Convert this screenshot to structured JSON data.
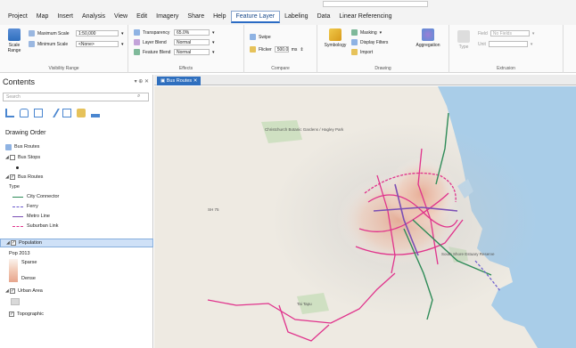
{
  "menubar": {
    "items": [
      "Project",
      "Map",
      "Insert",
      "Analysis",
      "View",
      "Edit",
      "Imagery",
      "Share",
      "Help",
      "Feature Layer",
      "Labeling",
      "Data",
      "Linear Referencing"
    ],
    "active_index": 9
  },
  "ribbon": {
    "visibility_range": {
      "scale_range_label": "Scale Range",
      "max_scale_label": "Maximum Scale",
      "max_scale_value": "1:50,000",
      "min_scale_label": "Minimum Scale",
      "min_scale_value": "<None>",
      "group_label": "Visibility Range"
    },
    "effects": {
      "transparency_label": "Transparency",
      "transparency_value": "65.0%",
      "layer_blend_label": "Layer Blend",
      "layer_blend_value": "Normal",
      "feature_blend_label": "Feature Blend",
      "feature_blend_value": "Normal",
      "group_label": "Effects"
    },
    "compare": {
      "swipe_label": "Swipe",
      "flicker_label": "Flicker",
      "flicker_value": "500.0",
      "flicker_unit": "ms",
      "group_label": "Compare"
    },
    "drawing": {
      "symbology_label": "Symbology",
      "masking_label": "Masking",
      "display_filters_label": "Display Filters",
      "import_label": "Import",
      "aggregation_label": "Aggregation",
      "group_label": "Drawing"
    },
    "extrusion": {
      "type_label": "Type",
      "field_label": "Field",
      "field_value": "No Fields",
      "unit_label": "Unit",
      "group_label": "Extrusion"
    }
  },
  "contents": {
    "title": "Contents",
    "search_placeholder": "Search",
    "drawing_order_label": "Drawing Order",
    "map_name": "Bus Routes",
    "layers": [
      {
        "name": "Bus Stops",
        "checked": false
      },
      {
        "name": "Bus Routes",
        "checked": true
      }
    ],
    "bus_routes_type_label": "Type",
    "bus_routes_legend": [
      {
        "label": "City Connector",
        "color": "#2e8b57",
        "style": "solid"
      },
      {
        "label": "Ferry",
        "color": "#6a5acd",
        "style": "dashed"
      },
      {
        "label": "Metro Line",
        "color": "#7b4fb5",
        "style": "solid"
      },
      {
        "label": "Suburban Link",
        "color": "#e0338c",
        "style": "dashed"
      }
    ],
    "population_layer": "Population",
    "population_field": "Pop 2013",
    "population_sparse": "Sparse",
    "population_dense": "Dense",
    "urban_area_layer": "Urban Area",
    "topographic_layer": "Topographic"
  },
  "map_tab": {
    "label": "Bus Routes"
  },
  "map_labels": {
    "park": "Christchurch Botanic Gardens / Hagley Park",
    "park2": "South Shore Estuary Reserve",
    "airport": "SH 75",
    "south": "Tai Tapu"
  },
  "colors": {
    "accent": "#2f6fbe",
    "sea": "#a9cde8",
    "land": "#eeeae2",
    "route_pink": "#e0338c",
    "route_purple": "#7b4fb5",
    "route_green": "#2e8b57"
  }
}
